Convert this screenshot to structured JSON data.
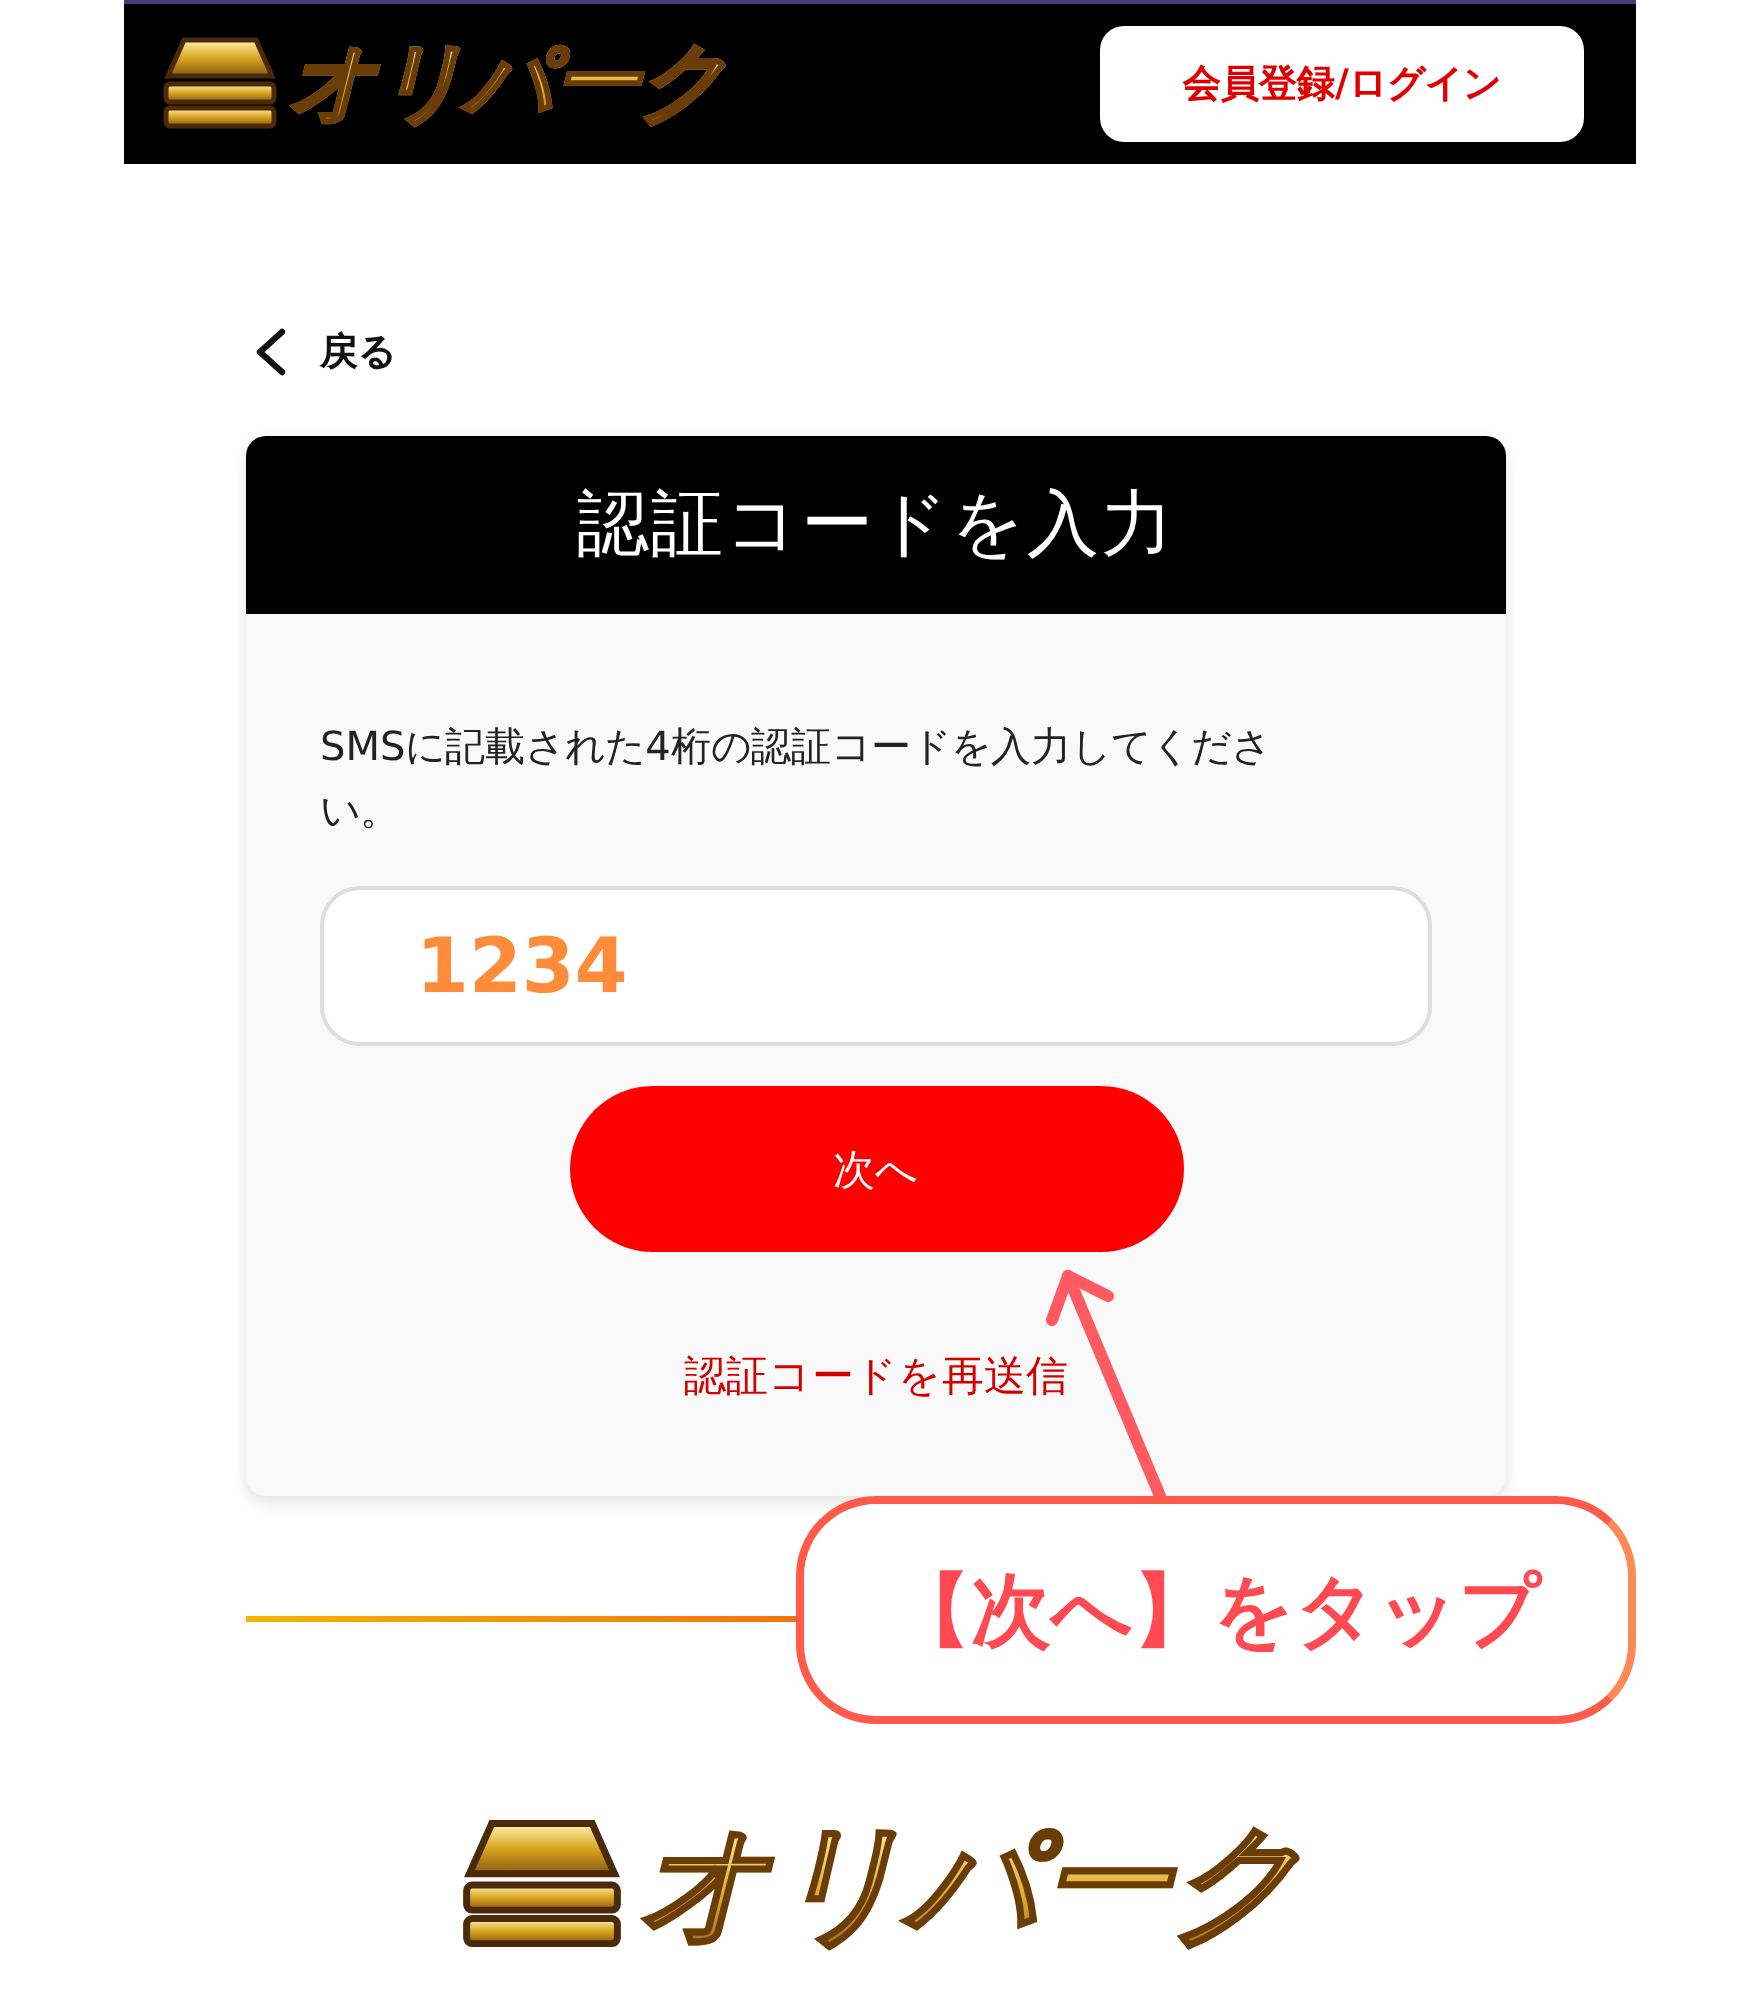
{
  "header": {
    "logo": "オリパーク",
    "login_button": "会員登録/ログイン"
  },
  "back_link": "戻る",
  "card": {
    "title": "認証コードを入力",
    "instructions": "SMSに記載された4桁の認証コードを入力してください。",
    "code_field": {
      "value": "1234"
    },
    "next_button": "次へ",
    "resend_link": "認証コードを再送信"
  },
  "annotation": {
    "callout": "【次へ】をタップ"
  },
  "footer": {
    "logo": "オリパーク"
  }
}
